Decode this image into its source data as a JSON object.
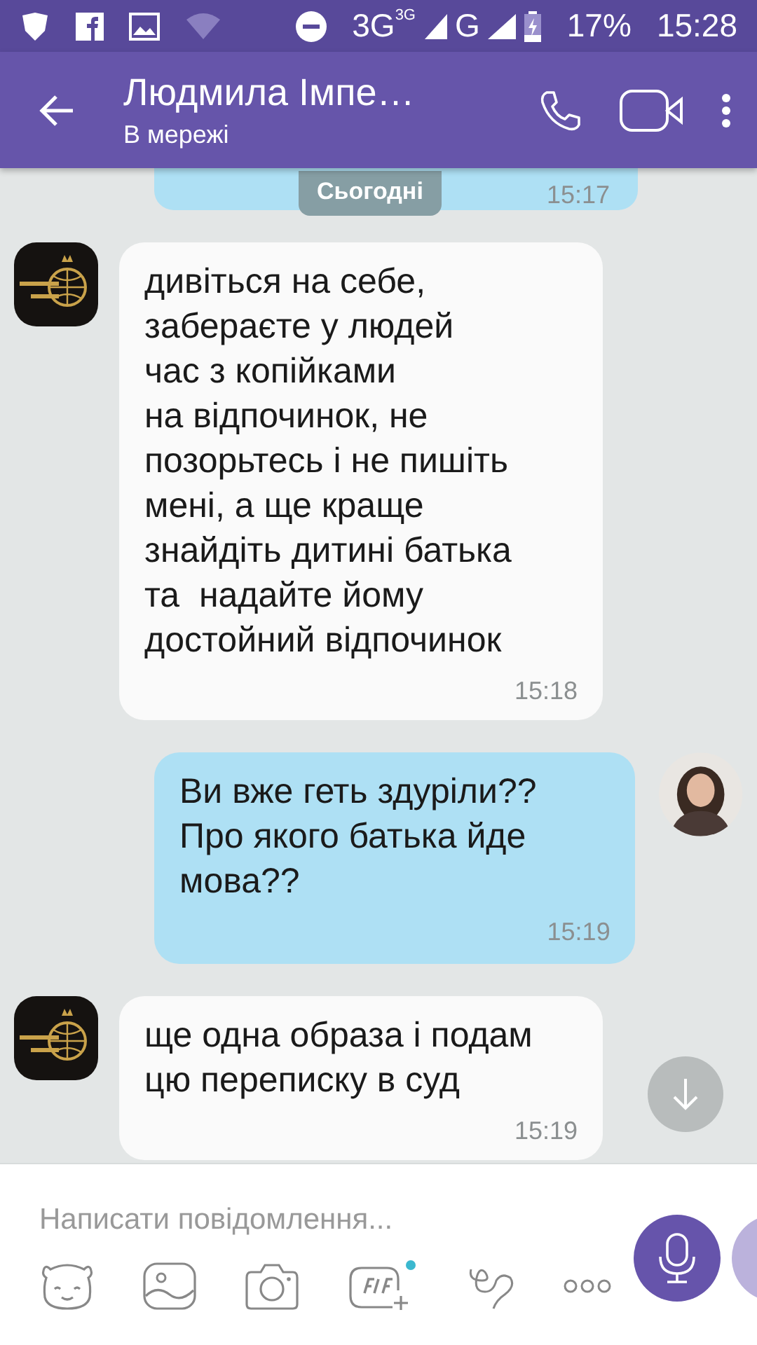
{
  "status_bar": {
    "network_1": "3G",
    "network_1_sup": "3G",
    "network_2": "G",
    "battery": "17%",
    "time": "15:28"
  },
  "header": {
    "title": "Людмила Імпе…",
    "status": "В мережі"
  },
  "date_chip": "Сьогодні",
  "messages": [
    {
      "kind": "partial",
      "outgoing": true,
      "time": "15:17"
    },
    {
      "kind": "text",
      "outgoing": false,
      "text": "дивіться на себе,\nзабераєте у людей\nчас з копійками\nна відпочинок, не\nпозорьтесь і не пишіть\nмені, а ще краще\nзнайдіть дитині батька\nта  надайте йому\nдостойний відпочинок",
      "time": "15:18"
    },
    {
      "kind": "text",
      "outgoing": true,
      "text": "Ви вже геть здуріли??\nПро якого батька йде\nмова??",
      "time": "15:19"
    },
    {
      "kind": "text",
      "outgoing": false,
      "text": "ще одна образа і подам\nцю переписку в суд",
      "time": "15:19"
    }
  ],
  "composer": {
    "placeholder": "Написати повідомлення..."
  }
}
